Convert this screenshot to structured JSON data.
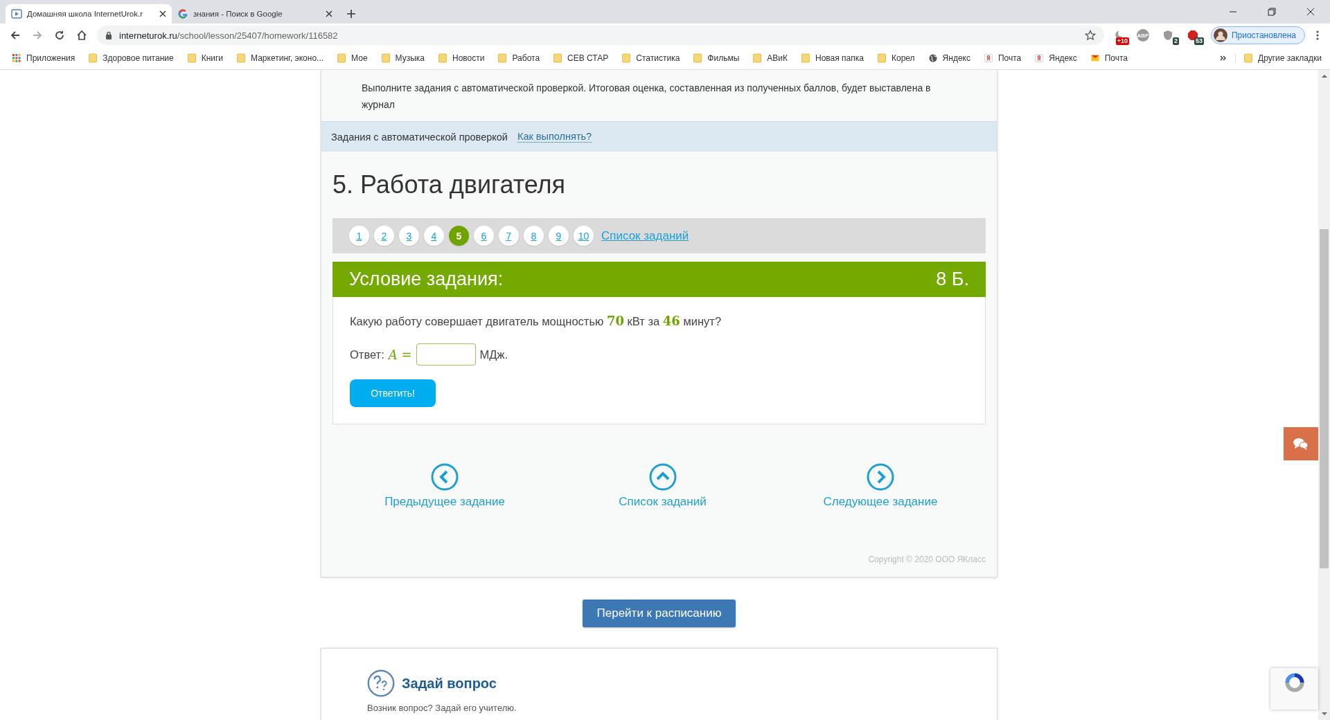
{
  "browser": {
    "tabs": [
      {
        "title": "Домашняя школа InternetUrok.r",
        "kind": "play",
        "selected": true
      },
      {
        "title": "знания - Поиск в Google",
        "kind": "google",
        "selected": false
      }
    ],
    "url_host": "interneturok.ru",
    "url_path": "/school/lesson/25407/homework/116582",
    "extensions": [
      {
        "kind": "moon",
        "badge": "+10"
      },
      {
        "kind": "abp",
        "label": "ABP"
      },
      {
        "kind": "shield",
        "badge": "2"
      },
      {
        "kind": "red",
        "badge": "53"
      }
    ],
    "profile": "Приостановлена",
    "bookmarks": [
      {
        "kind": "apps",
        "label": "Приложения"
      },
      {
        "kind": "folder",
        "label": "Здоровое питание"
      },
      {
        "kind": "folder",
        "label": "Книги"
      },
      {
        "kind": "folder",
        "label": "Маркетинг, эконо..."
      },
      {
        "kind": "folder",
        "label": "Мое"
      },
      {
        "kind": "folder",
        "label": "Музыка"
      },
      {
        "kind": "folder",
        "label": "Новости"
      },
      {
        "kind": "folder",
        "label": "Работа"
      },
      {
        "kind": "folder",
        "label": "СЕВ СТАР"
      },
      {
        "kind": "folder",
        "label": "Статистика"
      },
      {
        "kind": "folder",
        "label": "Фильмы"
      },
      {
        "kind": "folder",
        "label": "АВиК"
      },
      {
        "kind": "folder",
        "label": "Новая папка"
      },
      {
        "kind": "folder",
        "label": "Корел"
      },
      {
        "kind": "globe",
        "label": "Яндекс"
      },
      {
        "kind": "yandex",
        "label": "Почта"
      },
      {
        "kind": "yandex",
        "label": "Яндекс"
      },
      {
        "kind": "mail",
        "label": "Почта"
      }
    ],
    "other_bookmarks": "Другие закладки"
  },
  "page": {
    "intro": "Выполните задания с автоматической проверкой. Итоговая оценка, составленная из полученных баллов, будет выставлена в журнал",
    "auto_check": {
      "label": "Задания с автоматической проверкой",
      "link": "Как выполнять?"
    },
    "task_title": "5. Работа двигателя",
    "pagination": [
      {
        "label": "1",
        "selected": false
      },
      {
        "label": "2",
        "selected": false
      },
      {
        "label": "3",
        "selected": false
      },
      {
        "label": "4",
        "selected": false
      },
      {
        "label": "5",
        "selected": true
      },
      {
        "label": "6",
        "selected": false
      },
      {
        "label": "7",
        "selected": false
      },
      {
        "label": "8",
        "selected": false
      },
      {
        "label": "9",
        "selected": false
      },
      {
        "label": "10",
        "selected": false
      }
    ],
    "task_list_link": "Список заданий",
    "condition": {
      "title": "Условие задания:",
      "points": "8 Б."
    },
    "question": "Какую работу совершает двигатель мощностью **70** кВт за **46** минут?",
    "answer": {
      "label": "Ответ:",
      "variable": "A",
      "equals": "=",
      "unit": "МДж."
    },
    "submit": "Ответить!",
    "nav": [
      {
        "kind": "prev",
        "label": "Предыдущее задание"
      },
      {
        "kind": "up",
        "label": "Список заданий"
      },
      {
        "kind": "next",
        "label": "Следующее задание"
      }
    ],
    "copyright": "Copyright © 2020 ООО ЯКласс",
    "schedule_button": "Перейти к расписанию",
    "ask": {
      "title": "Задай вопрос",
      "text": "Возник вопрос? Задай его учителю."
    }
  }
}
